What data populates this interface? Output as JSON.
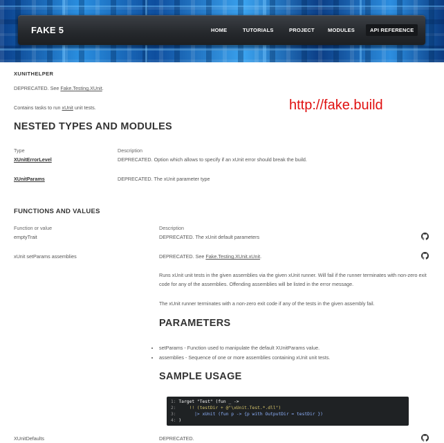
{
  "nav": {
    "brand": "FAKE 5",
    "items": [
      {
        "label": "HOME"
      },
      {
        "label": "TUTORIALS"
      },
      {
        "label": "PROJECT"
      },
      {
        "label": "MODULES"
      },
      {
        "label": "API REFERENCE",
        "active": true
      }
    ]
  },
  "module": {
    "name": "XUNITHELPER",
    "deprecated_prefix": "DEPRECATED. See ",
    "deprecated_link": "Fake.Testing.XUnit",
    "deprecated_suffix": ".",
    "summary_prefix": "Contains tasks to run ",
    "summary_link": "xUnit",
    "summary_suffix": " unit tests."
  },
  "watermark": "http://fake.build",
  "nested": {
    "heading": "NESTED TYPES AND MODULES",
    "col_type": "Type",
    "col_desc": "Description",
    "rows": [
      {
        "name": "XUnitErrorLevel",
        "desc": "DEPRECATED. Option which allows to specify if an xUnit error should break the build."
      },
      {
        "name": "XUnitParams",
        "desc": "DEPRECATED. The xUnit parameter type"
      }
    ]
  },
  "functions": {
    "heading": "FUNCTIONS AND VALUES",
    "col_fn": "Function or value",
    "col_desc": "Description",
    "rows": [
      {
        "name": "emptyTrait",
        "desc": "DEPRECATED. The xUnit default parameters"
      },
      {
        "name": "xUnit setParams assemblies",
        "desc_prefix": "DEPRECATED. See ",
        "desc_link": "Fake.Testing.XUnit.xUnit",
        "desc_suffix": "."
      },
      {
        "name": "XUnitDefaults",
        "desc": "DEPRECATED."
      }
    ],
    "xunit_detail": {
      "para1": "Runs xUnit unit tests in the given assemblies via the given xUnit runner. Will fail if the runner terminates with non-zero exit code for any of the assemblies. Offending assemblies will be listed in the error message.",
      "para2": "The xUnit runner terminates with a non-zero exit code if any of the tests in the given assembly fail.",
      "params_heading": "PARAMETERS",
      "params": [
        "setParams - Function used to manipulate the default XUnitParams value.",
        "assemblies - Sequence of one or more assemblies containing xUnit unit tests."
      ],
      "sample_heading": "SAMPLE USAGE",
      "code": [
        {
          "ln": "1:",
          "text": "Target \"Test\" (fun _ ->"
        },
        {
          "ln": "2:",
          "text": "    !! (testDir + @\"\\xUnit.Test.*.dll\")"
        },
        {
          "ln": "3:",
          "text": "      |> xUnit (fun p -> {p with OutputDir = testDir })"
        },
        {
          "ln": "4:",
          "text": ")"
        }
      ]
    }
  },
  "icons": {
    "source_link": "github-icon"
  }
}
